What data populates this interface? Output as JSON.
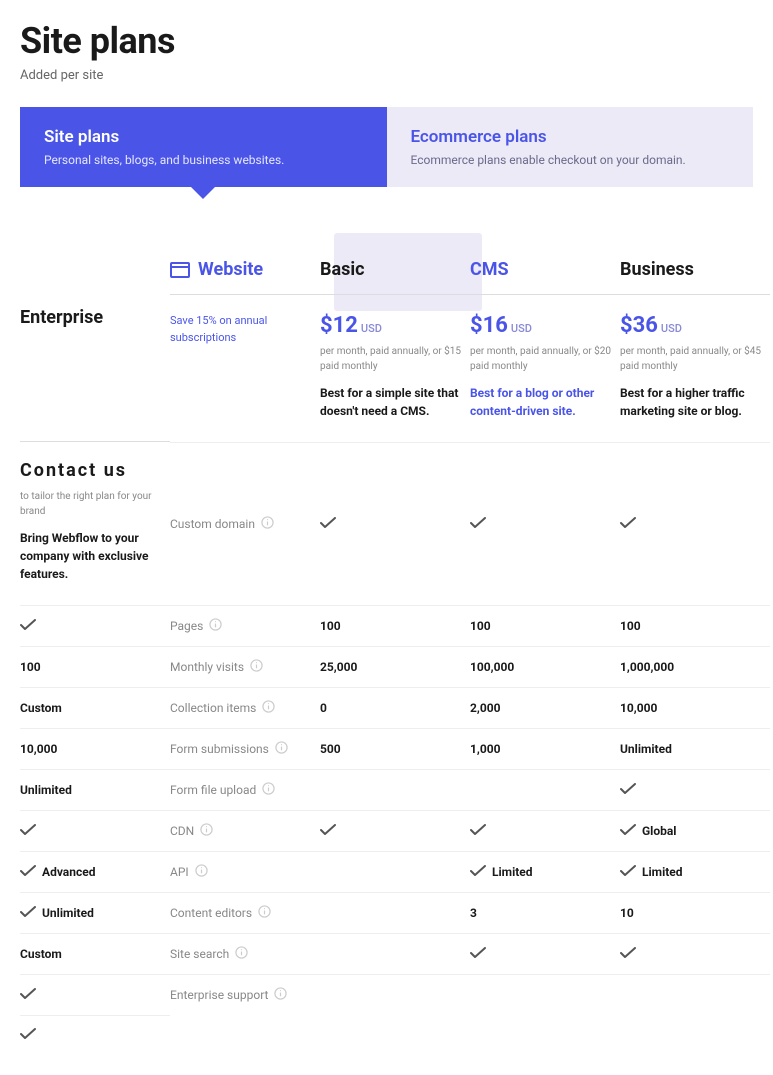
{
  "page": {
    "title": "Site plans",
    "subtitle": "Added per site"
  },
  "tabs": {
    "site": {
      "title": "Site plans",
      "desc": "Personal sites, blogs, and business websites."
    },
    "ecom": {
      "title": "Ecommerce plans",
      "desc": "Ecommerce plans enable checkout on your domain."
    }
  },
  "category": "Website",
  "savings_note": "Save 15% on annual subscriptions",
  "plans": {
    "basic": {
      "name": "Basic",
      "price": "$12",
      "currency": "USD",
      "sub": "per month, paid annually, or $15 paid monthly",
      "best": "Best for a simple site that doesn't need a CMS."
    },
    "cms": {
      "name": "CMS",
      "price": "$16",
      "currency": "USD",
      "sub": "per month, paid annually, or $20 paid monthly",
      "best": "Best for a blog or other content-driven site."
    },
    "business": {
      "name": "Business",
      "price": "$36",
      "currency": "USD",
      "sub": "per month, paid annually, or $45 paid monthly",
      "best": "Best for a higher traffic marketing site or blog."
    },
    "enterprise": {
      "name": "Enterprise",
      "contact": "Contact us",
      "sub": "to tailor the right plan for your brand",
      "best": "Bring Webflow to your company with exclusive features."
    }
  },
  "features": {
    "custom_domain": {
      "label": "Custom domain",
      "basic": {
        "check": true
      },
      "cms": {
        "check": true
      },
      "business": {
        "check": true
      },
      "enterprise": {
        "check": true
      }
    },
    "pages": {
      "label": "Pages",
      "basic": {
        "text": "100"
      },
      "cms": {
        "text": "100"
      },
      "business": {
        "text": "100"
      },
      "enterprise": {
        "text": "100"
      }
    },
    "monthly_visits": {
      "label": "Monthly visits",
      "basic": {
        "text": "25,000"
      },
      "cms": {
        "text": "100,000"
      },
      "business": {
        "text": "1,000,000"
      },
      "enterprise": {
        "text": "Custom"
      }
    },
    "collection_items": {
      "label": "Collection items",
      "basic": {
        "text": "0"
      },
      "cms": {
        "text": "2,000"
      },
      "business": {
        "text": "10,000"
      },
      "enterprise": {
        "text": "10,000"
      }
    },
    "form_submissions": {
      "label": "Form submissions",
      "basic": {
        "text": "500"
      },
      "cms": {
        "text": "1,000"
      },
      "business": {
        "text": "Unlimited"
      },
      "enterprise": {
        "text": "Unlimited"
      }
    },
    "form_file_upload": {
      "label": "Form file upload",
      "basic": {},
      "cms": {},
      "business": {
        "check": true
      },
      "enterprise": {
        "check": true
      }
    },
    "cdn": {
      "label": "CDN",
      "basic": {
        "check": true
      },
      "cms": {
        "check": true
      },
      "business": {
        "check": true,
        "text": "Global"
      },
      "enterprise": {
        "check": true,
        "text": "Advanced"
      }
    },
    "api": {
      "label": "API",
      "basic": {},
      "cms": {
        "check": true,
        "text": "Limited"
      },
      "business": {
        "check": true,
        "text": "Limited"
      },
      "enterprise": {
        "check": true,
        "text": "Unlimited"
      }
    },
    "content_editors": {
      "label": "Content editors",
      "basic": {},
      "cms": {
        "text": "3"
      },
      "business": {
        "text": "10"
      },
      "enterprise": {
        "text": "Custom"
      }
    },
    "site_search": {
      "label": "Site search",
      "basic": {},
      "cms": {
        "check": true
      },
      "business": {
        "check": true
      },
      "enterprise": {
        "check": true
      }
    },
    "enterprise_support": {
      "label": "Enterprise support",
      "basic": {},
      "cms": {},
      "business": {},
      "enterprise": {
        "check": true
      }
    }
  },
  "feature_order": [
    "custom_domain",
    "pages",
    "monthly_visits",
    "collection_items",
    "form_submissions",
    "form_file_upload",
    "cdn",
    "api",
    "content_editors",
    "site_search",
    "enterprise_support"
  ]
}
